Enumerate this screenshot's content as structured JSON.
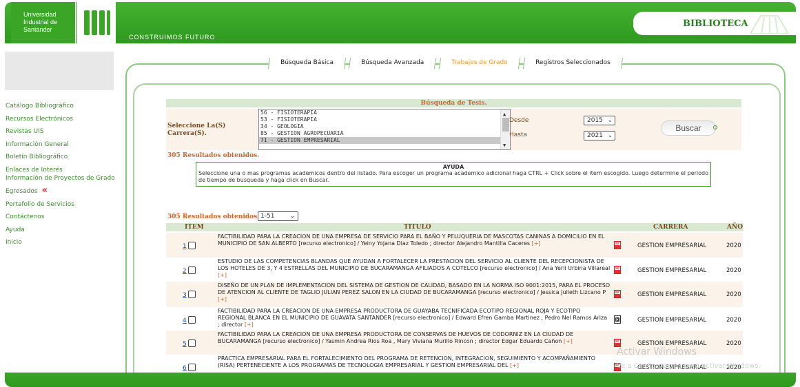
{
  "header": {
    "logo_text": "Universidad Industrial de Santander",
    "slogan": "CONSTRUIMOS FUTURO",
    "biblioteca": "BIBLIOTECA",
    "brand_green": "#3aa527"
  },
  "sidebar": {
    "items": [
      {
        "label": "Catálogo Bibliográfico"
      },
      {
        "label": "Recursos Electrónicos"
      },
      {
        "label": "Revistas UIS"
      },
      {
        "label": "Información General"
      },
      {
        "label": "Boletín Bibliográfico"
      },
      {
        "label": "Enlaces de Interés"
      },
      {
        "label": "Información de Proyectos de Grado"
      },
      {
        "label": "Egresados"
      },
      {
        "label": "Portafolio de Servicios"
      },
      {
        "label": "Contáctenos"
      },
      {
        "label": "Ayuda"
      },
      {
        "label": "Inicio"
      }
    ],
    "egresados_marker": "«"
  },
  "tabs": [
    {
      "label": "Búsqueda Básica",
      "active": false
    },
    {
      "label": "Búsqueda Avanzada",
      "active": false
    },
    {
      "label": "Trabajos de Grado",
      "active": true
    },
    {
      "label": "Registros Seleccionados",
      "active": false
    }
  ],
  "search": {
    "title": "Búsqueda de Tesis.",
    "select_label": "Seleccione La(S) Carrera(S).",
    "programs": [
      "56 - FISIOTERAPIA",
      "53 - FISIOTERAPIA",
      "34 - GEOLOGIA",
      "85 - GESTION AGROPECUARIA",
      "71 - GESTION EMPRESARIAL"
    ],
    "selected_program": "71 - GESTION EMPRESARIAL",
    "desde_label": "Desde",
    "desde_value": "2015",
    "hasta_label": "Hasta",
    "hasta_value": "2021",
    "buscar_label": "Buscar"
  },
  "results_count": "305 Resultados obtenidos.",
  "ayuda": {
    "title": "AYUDA",
    "text": "Seleccione una o mas programas academicos dentro del listado. Para escoger un programa academico adicional haga CTRL + Click sobre el item escogido. Luego determine el periodo de tiempo de busqueda y haga click en Buscar."
  },
  "pagination": {
    "label": "305 Resultados obtenidos.",
    "range": "1-51"
  },
  "table": {
    "headers": {
      "item": "ITEM",
      "titulo": "TITULO",
      "carrera": "CARRERA",
      "anio": "AÑO"
    },
    "more_label": "[+]",
    "rows": [
      {
        "num": "1",
        "title": "FACTIBILIDAD PARA LA CREACION DE UNA EMPRESA DE SERVICIO PARA EL BAÑO Y PELUQUERIA DE MASCOTAS CANINAS A DOMICILIO EN EL MUNICIPIO DE SAN ALBERTO [recurso electronico] / Yeiny Yojana Diaz Toledo ; director Alejandro Mantilla Caceres",
        "carrera": "GESTION EMPRESARIAL",
        "anio": "2020",
        "icon": "pdf-icon"
      },
      {
        "num": "2",
        "title": "ESTUDIO DE LAS COMPETENCIAS BLANDAS QUE AYUDAN A FORTALECER LA PRESTACION DEL SERVICIO AL CLIENTE DEL RECEPCIONISTA DE LOS HOTELES DE 3, Y 4 ESTRELLAS DEL MUNICIPIO DE BUCARAMANGA AFILIADOS A COTELCO [recurso electronico] / Ana Yerli Urbina Villareal",
        "carrera": "GESTION EMPRESARIAL",
        "anio": "2020",
        "icon": "pdf-icon"
      },
      {
        "num": "3",
        "title": "DISEÑO DE UN PLAN DE IMPLEMENTACION DEL SISTEMA DE GESTION DE CALIDAD, BASADO EN LA NORMA ISO 9001:2015, PARA EL PROCESO DE ATENCION AL CLIENTE DE TAGLIO JULIAN PEREZ SALON EN LA CIUDAD DE BUCARAMANGA [recurso electronico] / Jessica Julieth Lizcano P",
        "carrera": "GESTION EMPRESARIAL",
        "anio": "2020",
        "icon": "pdf-icon"
      },
      {
        "num": "4",
        "title": "FACTIBILIDAD PARA LA CREACION DE UNA EMPRESA PRODUCTORA DE GUAYABA TECNIFICADA ECOTIPO REGIONAL ROJA Y ECOTIPO REGIONAL BLANCA EN EL MUNICIPIO DE GUAVATA SANTANDER [recurso electronico] / Edward Efren Gamba Martinez , Pedro Nel Ramos Ariza ; director",
        "carrera": "GESTION EMPRESARIAL",
        "anio": "2020",
        "icon": "video-icon"
      },
      {
        "num": "5",
        "title": "FACTIBILIDAD PARA LA CREACION DE UNA EMPRESA PRODUCTORA DE CONSERVAS DE HUEVOS DE CODORNIZ EN LA CIUDAD DE BUCARAMANGA [recurso electronico] / Yasmin Andrea Rios Roa , Mary Viviana Murillo Rincon ; director Edgar Eduardo Cañon",
        "carrera": "GESTION EMPRESARIAL",
        "anio": "2020",
        "icon": "pdf-icon"
      },
      {
        "num": "6",
        "title": "PRACTICA EMPRESARIAL PARA EL FORTALECIMIENTO DEL PROGRAMA DE RETENCION, INTEGRACION, SEGUIMIENTO Y ACOMPAÑAMIENTO (RISA) PERTENECIENTE A LOS PROGRAMAS DE TECNOLOGIA EMPRESARIAL Y GESTION EMPRESARIAL DEL",
        "carrera": "GESTION EMPRESARIAL",
        "anio": "2020",
        "icon": "pdf-icon"
      }
    ]
  },
  "watermark": {
    "line1": "Activar Windows",
    "line2": "Ve a Configuración para activar Windows."
  }
}
